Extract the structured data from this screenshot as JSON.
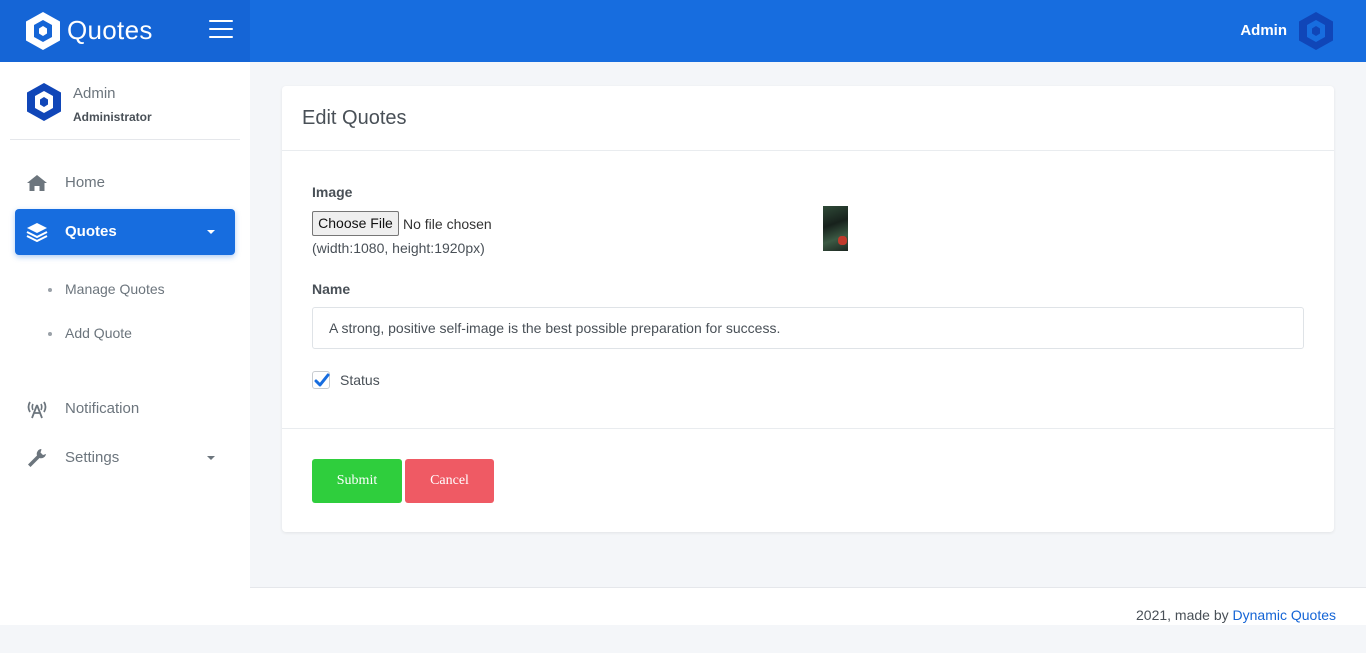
{
  "app": {
    "brand": "Quotes",
    "top_user": "Admin"
  },
  "sidebar": {
    "user_name": "Admin",
    "user_role": "Administrator",
    "items": [
      {
        "label": "Home",
        "icon": "home-icon"
      },
      {
        "label": "Quotes",
        "icon": "layers-icon",
        "active": true
      },
      {
        "label": "Notification",
        "icon": "broadcast-icon"
      },
      {
        "label": "Settings",
        "icon": "wrench-icon"
      }
    ],
    "sub_items": [
      {
        "label": "Manage Quotes"
      },
      {
        "label": "Add Quote"
      }
    ]
  },
  "form": {
    "title": "Edit Quotes",
    "image_label": "Image",
    "file_button": "Choose File",
    "file_status": "No file chosen",
    "file_hint": "(width:1080, height:1920px)",
    "name_label": "Name",
    "name_value": "A strong, positive self-image is the best possible preparation for success.",
    "status_label": "Status",
    "status_checked": true,
    "submit_label": "Submit",
    "cancel_label": "Cancel"
  },
  "footer": {
    "text": "2021, made by ",
    "link": "Dynamic Quotes"
  },
  "colors": {
    "primary": "#176ddf",
    "submit": "#2fce3d",
    "cancel": "#ef5a64"
  }
}
